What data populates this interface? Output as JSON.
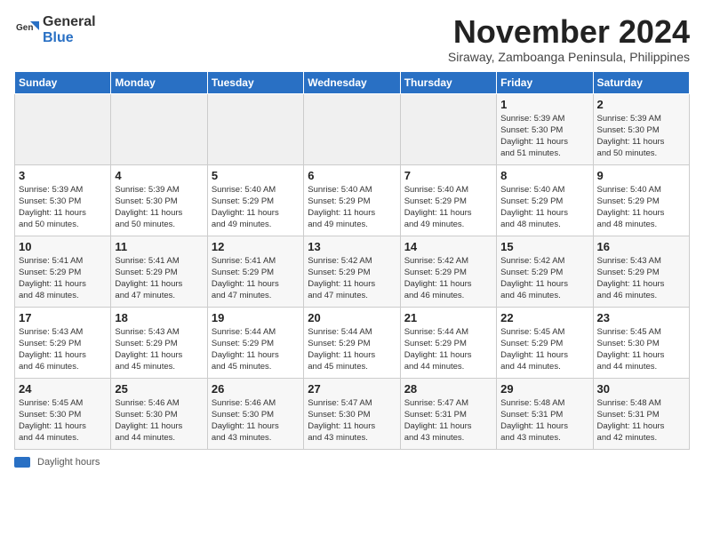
{
  "header": {
    "logo_general": "General",
    "logo_blue": "Blue",
    "month_title": "November 2024",
    "subtitle": "Siraway, Zamboanga Peninsula, Philippines"
  },
  "weekdays": [
    "Sunday",
    "Monday",
    "Tuesday",
    "Wednesday",
    "Thursday",
    "Friday",
    "Saturday"
  ],
  "weeks": [
    [
      {
        "day": "",
        "info": ""
      },
      {
        "day": "",
        "info": ""
      },
      {
        "day": "",
        "info": ""
      },
      {
        "day": "",
        "info": ""
      },
      {
        "day": "",
        "info": ""
      },
      {
        "day": "1",
        "info": "Sunrise: 5:39 AM\nSunset: 5:30 PM\nDaylight: 11 hours\nand 51 minutes."
      },
      {
        "day": "2",
        "info": "Sunrise: 5:39 AM\nSunset: 5:30 PM\nDaylight: 11 hours\nand 50 minutes."
      }
    ],
    [
      {
        "day": "3",
        "info": "Sunrise: 5:39 AM\nSunset: 5:30 PM\nDaylight: 11 hours\nand 50 minutes."
      },
      {
        "day": "4",
        "info": "Sunrise: 5:39 AM\nSunset: 5:30 PM\nDaylight: 11 hours\nand 50 minutes."
      },
      {
        "day": "5",
        "info": "Sunrise: 5:40 AM\nSunset: 5:29 PM\nDaylight: 11 hours\nand 49 minutes."
      },
      {
        "day": "6",
        "info": "Sunrise: 5:40 AM\nSunset: 5:29 PM\nDaylight: 11 hours\nand 49 minutes."
      },
      {
        "day": "7",
        "info": "Sunrise: 5:40 AM\nSunset: 5:29 PM\nDaylight: 11 hours\nand 49 minutes."
      },
      {
        "day": "8",
        "info": "Sunrise: 5:40 AM\nSunset: 5:29 PM\nDaylight: 11 hours\nand 48 minutes."
      },
      {
        "day": "9",
        "info": "Sunrise: 5:40 AM\nSunset: 5:29 PM\nDaylight: 11 hours\nand 48 minutes."
      }
    ],
    [
      {
        "day": "10",
        "info": "Sunrise: 5:41 AM\nSunset: 5:29 PM\nDaylight: 11 hours\nand 48 minutes."
      },
      {
        "day": "11",
        "info": "Sunrise: 5:41 AM\nSunset: 5:29 PM\nDaylight: 11 hours\nand 47 minutes."
      },
      {
        "day": "12",
        "info": "Sunrise: 5:41 AM\nSunset: 5:29 PM\nDaylight: 11 hours\nand 47 minutes."
      },
      {
        "day": "13",
        "info": "Sunrise: 5:42 AM\nSunset: 5:29 PM\nDaylight: 11 hours\nand 47 minutes."
      },
      {
        "day": "14",
        "info": "Sunrise: 5:42 AM\nSunset: 5:29 PM\nDaylight: 11 hours\nand 46 minutes."
      },
      {
        "day": "15",
        "info": "Sunrise: 5:42 AM\nSunset: 5:29 PM\nDaylight: 11 hours\nand 46 minutes."
      },
      {
        "day": "16",
        "info": "Sunrise: 5:43 AM\nSunset: 5:29 PM\nDaylight: 11 hours\nand 46 minutes."
      }
    ],
    [
      {
        "day": "17",
        "info": "Sunrise: 5:43 AM\nSunset: 5:29 PM\nDaylight: 11 hours\nand 46 minutes."
      },
      {
        "day": "18",
        "info": "Sunrise: 5:43 AM\nSunset: 5:29 PM\nDaylight: 11 hours\nand 45 minutes."
      },
      {
        "day": "19",
        "info": "Sunrise: 5:44 AM\nSunset: 5:29 PM\nDaylight: 11 hours\nand 45 minutes."
      },
      {
        "day": "20",
        "info": "Sunrise: 5:44 AM\nSunset: 5:29 PM\nDaylight: 11 hours\nand 45 minutes."
      },
      {
        "day": "21",
        "info": "Sunrise: 5:44 AM\nSunset: 5:29 PM\nDaylight: 11 hours\nand 44 minutes."
      },
      {
        "day": "22",
        "info": "Sunrise: 5:45 AM\nSunset: 5:29 PM\nDaylight: 11 hours\nand 44 minutes."
      },
      {
        "day": "23",
        "info": "Sunrise: 5:45 AM\nSunset: 5:30 PM\nDaylight: 11 hours\nand 44 minutes."
      }
    ],
    [
      {
        "day": "24",
        "info": "Sunrise: 5:45 AM\nSunset: 5:30 PM\nDaylight: 11 hours\nand 44 minutes."
      },
      {
        "day": "25",
        "info": "Sunrise: 5:46 AM\nSunset: 5:30 PM\nDaylight: 11 hours\nand 44 minutes."
      },
      {
        "day": "26",
        "info": "Sunrise: 5:46 AM\nSunset: 5:30 PM\nDaylight: 11 hours\nand 43 minutes."
      },
      {
        "day": "27",
        "info": "Sunrise: 5:47 AM\nSunset: 5:30 PM\nDaylight: 11 hours\nand 43 minutes."
      },
      {
        "day": "28",
        "info": "Sunrise: 5:47 AM\nSunset: 5:31 PM\nDaylight: 11 hours\nand 43 minutes."
      },
      {
        "day": "29",
        "info": "Sunrise: 5:48 AM\nSunset: 5:31 PM\nDaylight: 11 hours\nand 43 minutes."
      },
      {
        "day": "30",
        "info": "Sunrise: 5:48 AM\nSunset: 5:31 PM\nDaylight: 11 hours\nand 42 minutes."
      }
    ]
  ],
  "footer": {
    "swatch_label": "Daylight hours"
  }
}
